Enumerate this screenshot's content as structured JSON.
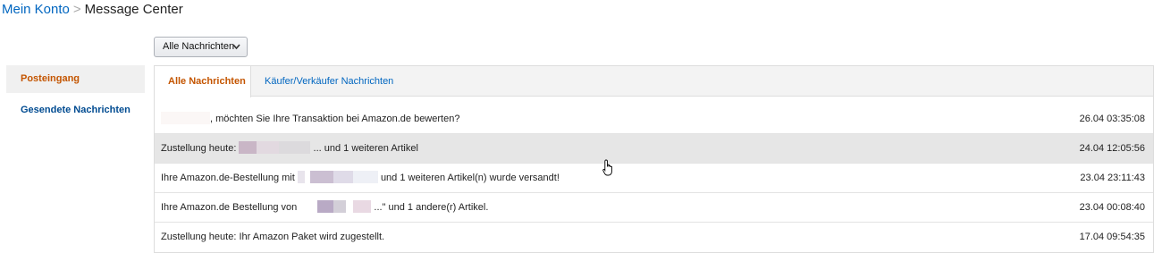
{
  "breadcrumb": {
    "root": "Mein Konto",
    "separator": ">",
    "current": "Message Center"
  },
  "filter": {
    "selected": "Alle Nachrichten"
  },
  "sidebar": {
    "items": [
      {
        "label": "Posteingang"
      },
      {
        "label": "Gesendete Nachrichten"
      }
    ]
  },
  "tabs": [
    {
      "label": "Alle Nachrichten"
    },
    {
      "label": "Käufer/Verkäufer Nachrichten"
    }
  ],
  "messages": [
    {
      "subject_suffix": ", möchten Sie Ihre Transaktion bei Amazon.de bewerten?",
      "date": "26.04 03:35:08"
    },
    {
      "subject_prefix": "Zustellung heute:",
      "subject_suffix": "... und 1 weiteren Artikel",
      "date": "24.04 12:05:56"
    },
    {
      "subject_prefix": "Ihre Amazon.de-Bestellung mit",
      "subject_suffix": "und 1 weiteren Artikel(n) wurde versandt!",
      "date": "23.04 23:11:43"
    },
    {
      "subject_prefix": "Ihre Amazon.de Bestellung von",
      "subject_suffix": "...\" und 1 andere(r) Artikel.",
      "date": "23.04 00:08:40"
    },
    {
      "subject": "Zustellung heute: Ihr Amazon Paket wird zugestellt.",
      "date": "17.04 09:54:35"
    }
  ],
  "colors": {
    "link": "#0066c0",
    "active_tab": "#c45500",
    "sidebar_link": "#004b91",
    "row_highlight": "#e6e6e6"
  }
}
